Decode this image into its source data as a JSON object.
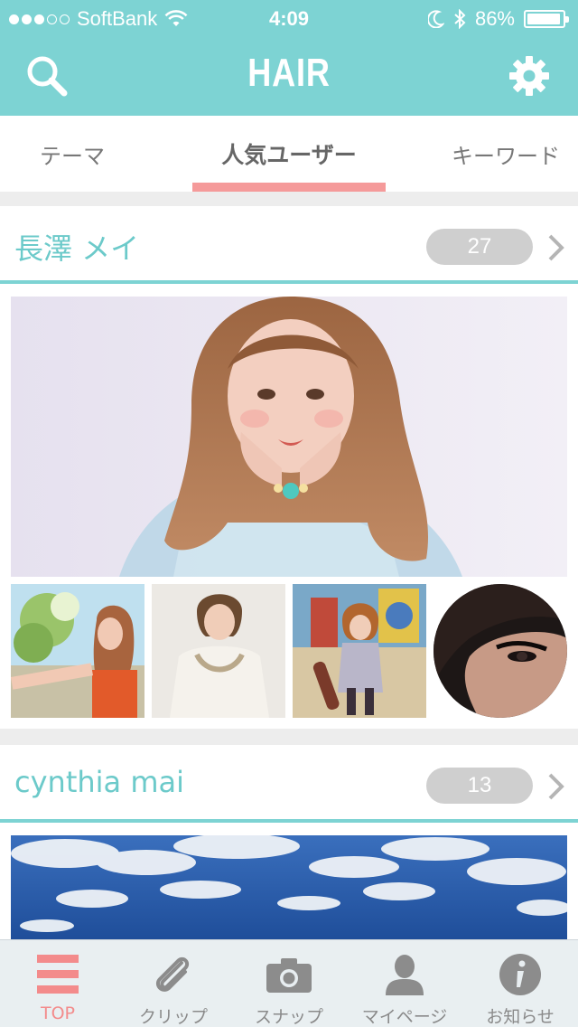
{
  "status_bar": {
    "carrier": "SoftBank",
    "time": "4:09",
    "battery": "86%",
    "signal_bars_filled": 3,
    "signal_bars_total": 5
  },
  "nav": {
    "title": "HAIR"
  },
  "tabs": [
    {
      "label": "テーマ",
      "active": false
    },
    {
      "label": "人気ユーザー",
      "active": true
    },
    {
      "label": "キーワード",
      "active": false
    }
  ],
  "users": [
    {
      "name": "長澤 メイ",
      "count": "27"
    },
    {
      "name": "cynthia mai",
      "count": "13"
    }
  ],
  "tab_bar": {
    "items": [
      {
        "label": "TOP",
        "icon": "menu-icon",
        "active": true
      },
      {
        "label": "クリップ",
        "icon": "paperclip-icon",
        "active": false
      },
      {
        "label": "スナップ",
        "icon": "camera-icon",
        "active": false
      },
      {
        "label": "マイページ",
        "icon": "person-icon",
        "active": false
      },
      {
        "label": "お知らせ",
        "icon": "info-icon",
        "active": false
      }
    ]
  },
  "colors": {
    "brand": "#7dd3d3",
    "accent": "#f59a9a",
    "user_name": "#6ccaca"
  }
}
